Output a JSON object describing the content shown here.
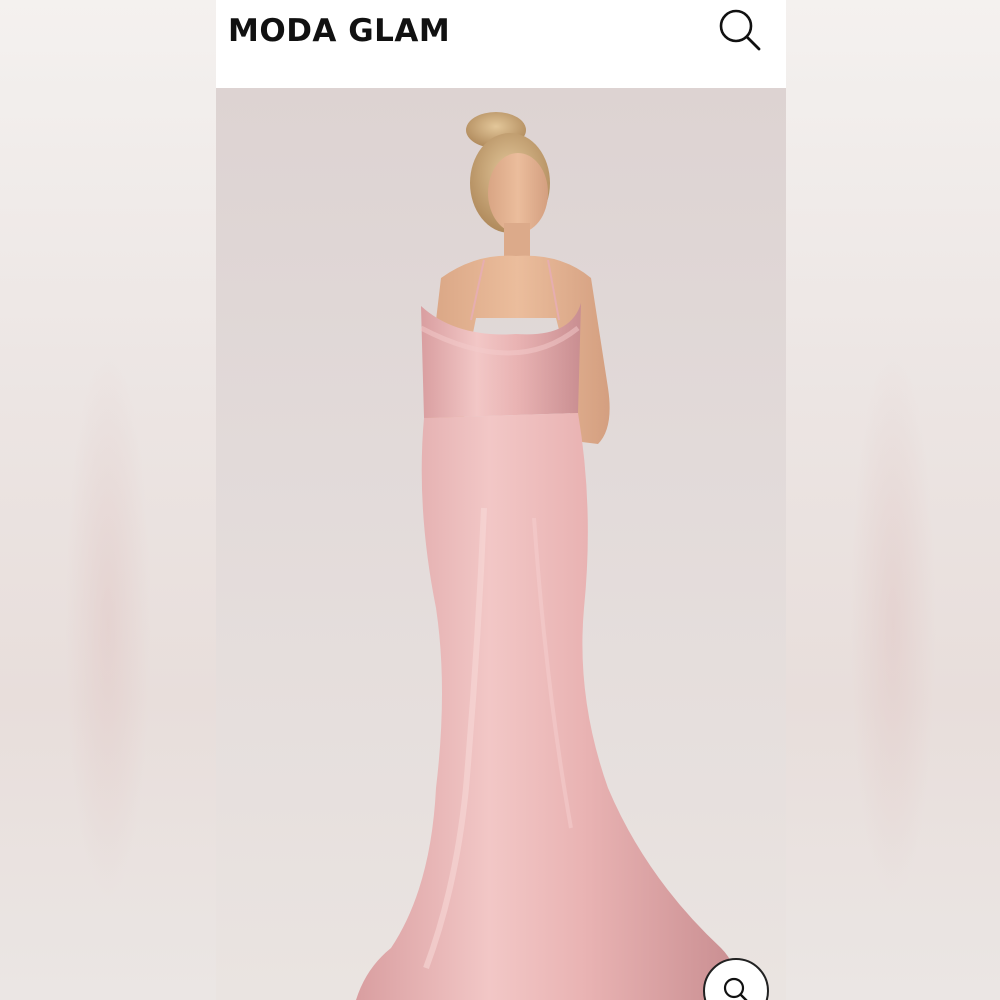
{
  "header": {
    "brand": "MODA GLAM",
    "search_icon": "search-icon"
  },
  "product_image": {
    "description_icon": "product-photo",
    "dress_color": "#e8b5b5",
    "background_color": "#e2dad9"
  },
  "zoom_button": {
    "icon": "zoom-icon"
  }
}
